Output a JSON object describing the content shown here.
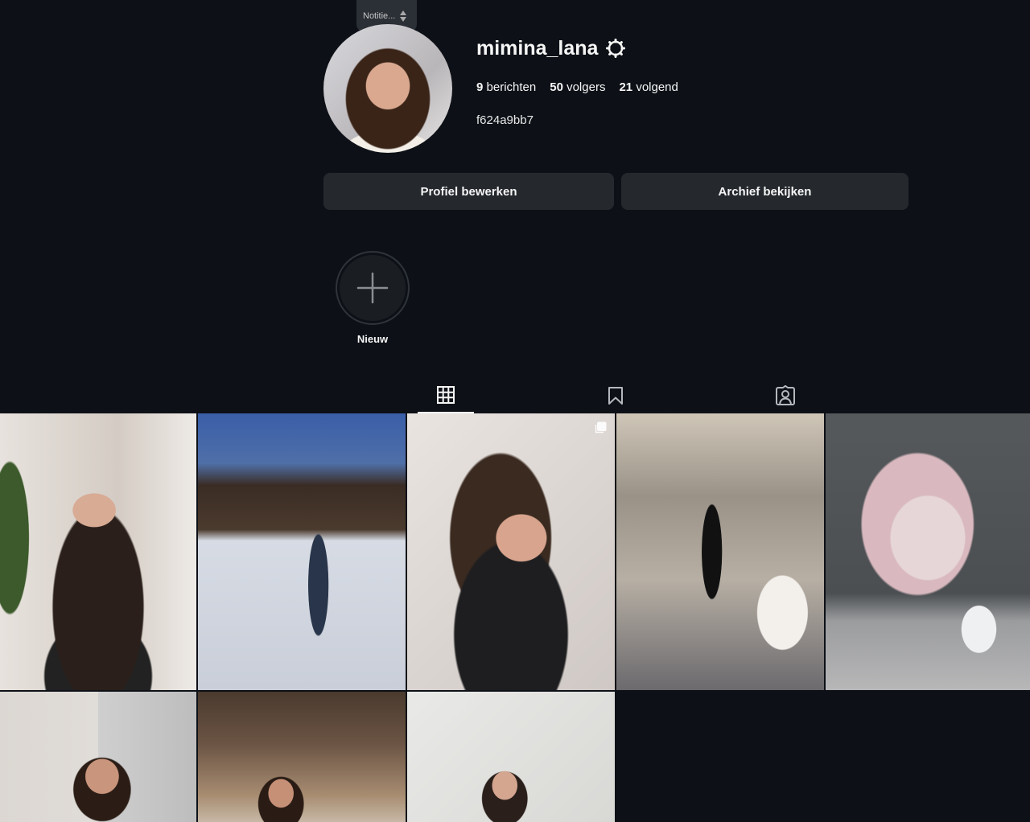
{
  "note": {
    "text": "Notitie..."
  },
  "profile": {
    "username": "mimina_lana",
    "stats": {
      "posts_count": "9",
      "posts_label": "berichten",
      "followers_count": "50",
      "followers_label": "volgers",
      "following_count": "21",
      "following_label": "volgend"
    },
    "bio": "f624a9bb7"
  },
  "buttons": {
    "edit_profile": "Profiel bewerken",
    "view_archive": "Archief bekijken"
  },
  "highlight_new": {
    "label": "Nieuw"
  },
  "tabs": [
    {
      "icon": "grid-icon",
      "active": true
    },
    {
      "icon": "bookmark-icon",
      "active": false
    },
    {
      "icon": "tagged-user-icon",
      "active": false
    }
  ],
  "colors": {
    "background": "#0d1117",
    "button_bg": "#25292e",
    "text": "#f5f5f5"
  }
}
